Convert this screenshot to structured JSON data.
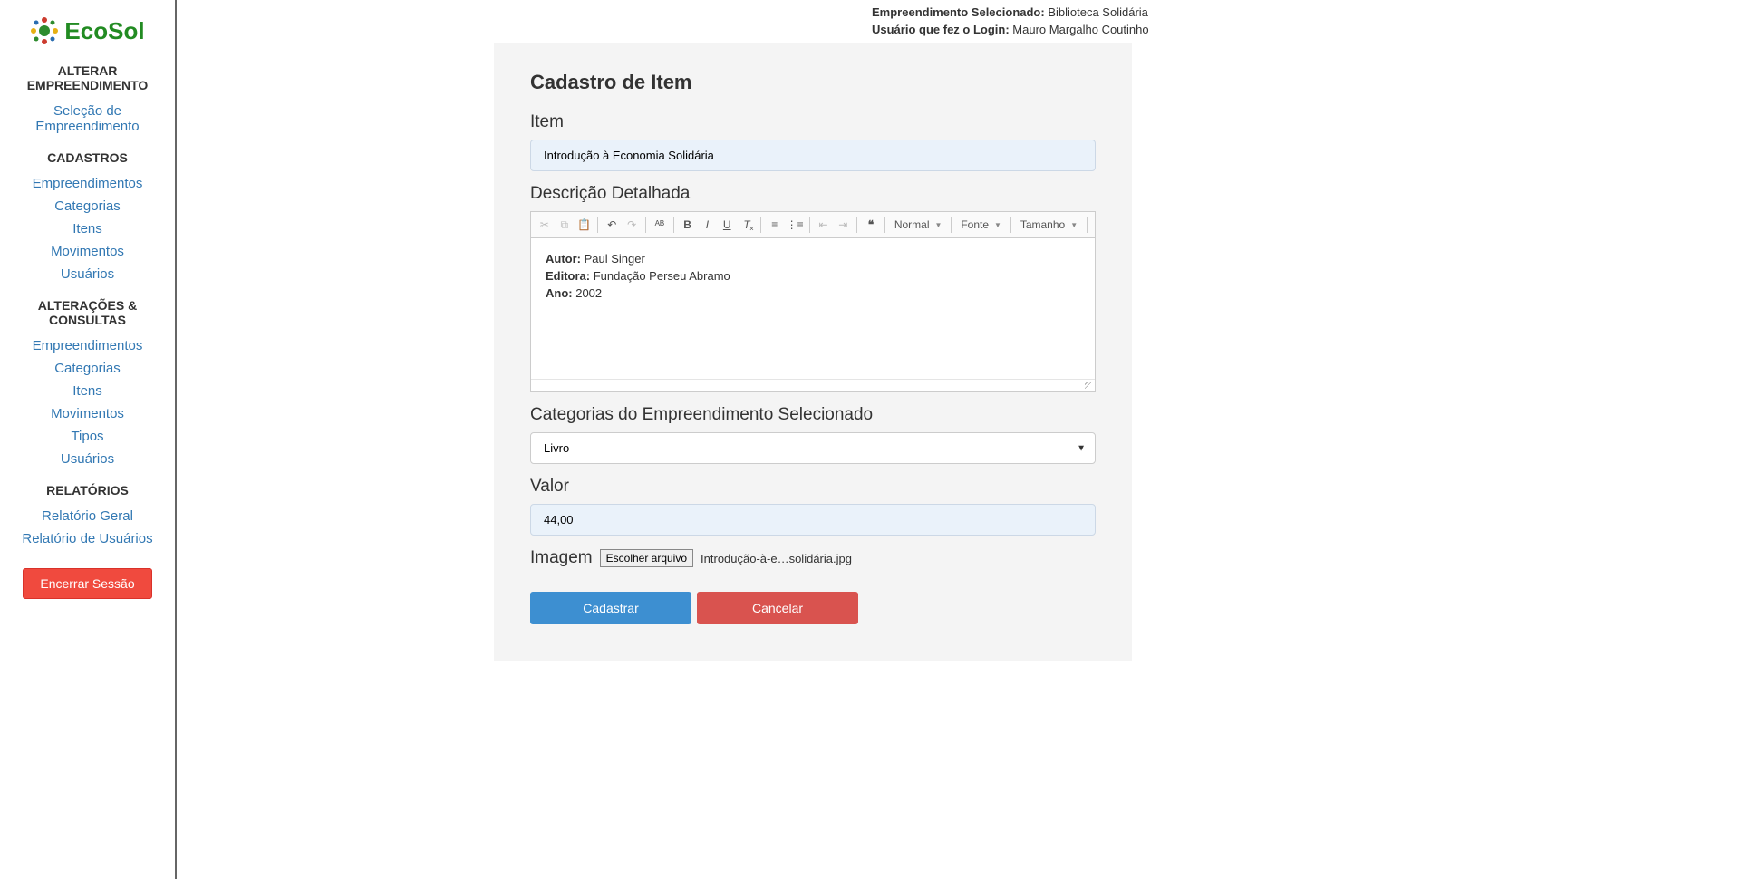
{
  "logo": {
    "text": "EcoSol"
  },
  "sidebar": {
    "section1": {
      "heading": "ALTERAR EMPREENDIMENTO",
      "links": [
        "Seleção de Empreendimento"
      ]
    },
    "section2": {
      "heading": "CADASTROS",
      "links": [
        "Empreendimentos",
        "Categorias",
        "Itens",
        "Movimentos",
        "Usuários"
      ]
    },
    "section3": {
      "heading": "ALTERAÇÕES & CONSULTAS",
      "links": [
        "Empreendimentos",
        "Categorias",
        "Itens",
        "Movimentos",
        "Tipos",
        "Usuários"
      ]
    },
    "section4": {
      "heading": "RELATÓRIOS",
      "links": [
        "Relatório Geral",
        "Relatório de Usuários"
      ]
    },
    "logout": "Encerrar Sessão"
  },
  "topbar": {
    "empreendimento_label": "Empreendimento Selecionado:",
    "empreendimento_value": "Biblioteca Solidária",
    "usuario_label": "Usuário que fez o Login:",
    "usuario_value": "Mauro Margalho Coutinho"
  },
  "form": {
    "title": "Cadastro de Item",
    "item_label": "Item",
    "item_value": "Introdução à Economia Solidária",
    "descricao_label": "Descrição Detalhada",
    "toolbar": {
      "format": "Normal",
      "font": "Fonte",
      "size": "Tamanho"
    },
    "descricao_lines": {
      "autor_label": "Autor:",
      "autor_value": " Paul Singer",
      "editora_label": "Editora:",
      "editora_value": " Fundação Perseu Abramo",
      "ano_label": "Ano:",
      "ano_value": " 2002"
    },
    "categorias_label": "Categorias do Empreendimento Selecionado",
    "categorias_value": "Livro",
    "valor_label": "Valor",
    "valor_value": "44,00",
    "imagem_label": "Imagem",
    "imagem_button": "Escolher arquivo",
    "imagem_filename": "Introdução-à-e…solidária.jpg",
    "submit": "Cadastrar",
    "cancel": "Cancelar"
  }
}
